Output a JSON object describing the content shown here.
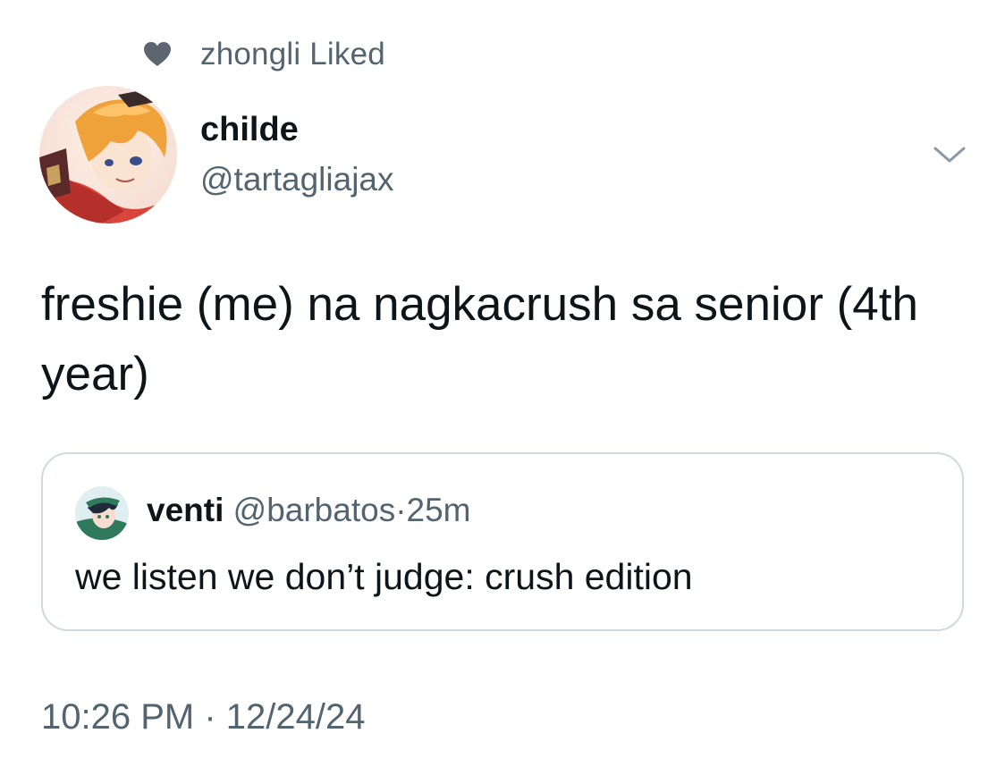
{
  "social_context": {
    "icon": "heart-icon",
    "text": "zhongli Liked"
  },
  "author": {
    "display_name": "childe",
    "handle": "@tartagliajax",
    "avatar": "avatar-image"
  },
  "menu": {
    "icon": "chevron-down-icon"
  },
  "tweet": {
    "text": "freshie (me) na nagkacrush sa senior (4th year)"
  },
  "quoted_tweet": {
    "display_name": "venti",
    "handle": "@barbatos",
    "separator": "·",
    "time": "25m",
    "text": "we listen we don’t judge: crush edition"
  },
  "meta": {
    "timestamp": "10:26 PM · 12/24/24"
  },
  "colors": {
    "primary_text": "#0f1419",
    "secondary_text": "#536471",
    "border": "#cfd9de",
    "heart": "#5b6670"
  }
}
